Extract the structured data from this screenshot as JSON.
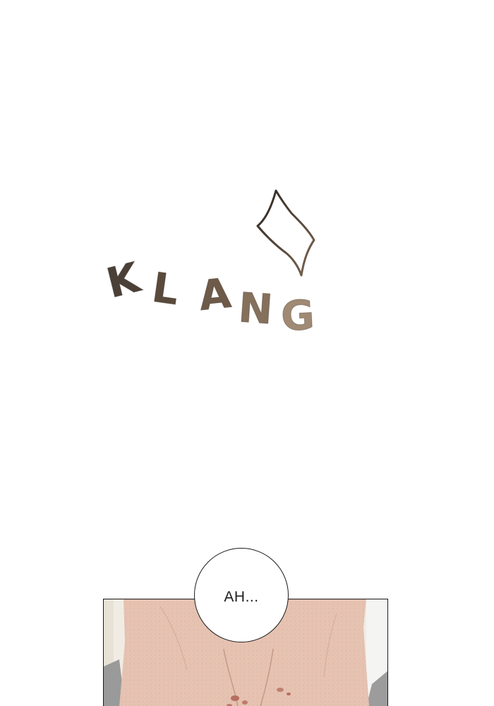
{
  "sound_effect": {
    "text": "KLANG",
    "letters": [
      "K",
      "L",
      "A",
      "N",
      "G"
    ],
    "gradient_colors": [
      "#4a4038",
      "#5a4a3c",
      "#6e5a48",
      "#85705c",
      "#a08a74"
    ]
  },
  "speech_bubble": {
    "text": "AH..."
  },
  "panel": {
    "skin_color": "#e6c3b2",
    "background_color": "#efe8dd",
    "scar_color": "#c9887a"
  }
}
